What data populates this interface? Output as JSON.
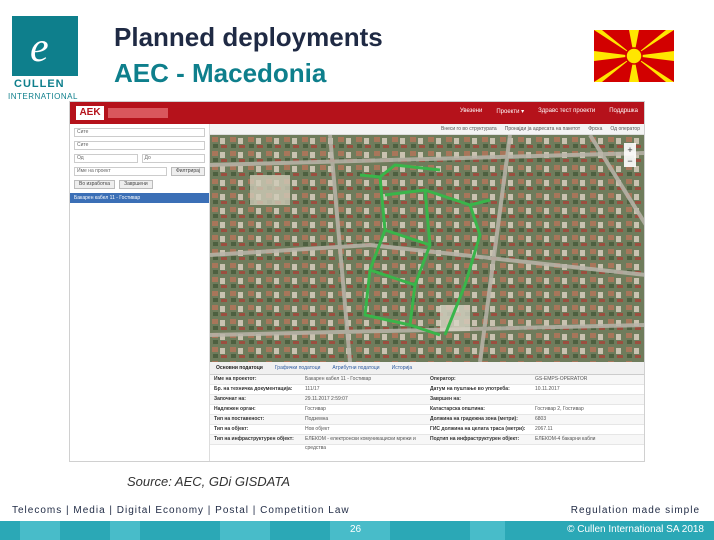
{
  "header": {
    "logo_name": "CULLEN",
    "logo_sub": "INTERNATIONAL",
    "title": "Planned deployments",
    "subtitle": "AEC - Macedonia"
  },
  "flag": {
    "field_color": "#d20000",
    "sun_color": "#ffe600"
  },
  "app": {
    "logo": "AEK",
    "menu": [
      "Увезени",
      "Проекти ▾",
      "Здравс тест проекти",
      "Поддршка"
    ],
    "bar2": [
      "Внеси го во структурата",
      "Пронајди ја адресата на пакетот",
      "Фрска",
      "Од оператор"
    ],
    "filters": {
      "field1": "Сите",
      "field2": "Сите",
      "from": "Од",
      "to": "До",
      "search": "Име на проект",
      "filter_btn": "Филтрирај",
      "btn1": "Во изработка",
      "btn2": "Завршени",
      "result": "Бакарен кабел 11 - Гостивар"
    },
    "tabs": [
      "Основни податоци",
      "Графички податоци",
      "Атрибутни податоци",
      "Историја"
    ],
    "info": [
      [
        "Име на проектот:",
        "Бакарен кабел 11 - Гостивар",
        "Оператор:",
        "GS-EMPS-OPERATOR"
      ],
      [
        "Бр. на техничка документација:",
        "111/17",
        "Датум на пуштање во употреба:",
        "10.11.2017"
      ],
      [
        "Започнат на:",
        "29.11.2017 2:59:07",
        "Завршен на:",
        ""
      ],
      [
        "Надлежен орган:",
        "Гостивар",
        "Катастарска општина:",
        "Гостивар 2, Гостивар"
      ],
      [
        "Тип на поставеност:",
        "Подземна",
        "Должина на градежна зона (метри):",
        "6803"
      ],
      [
        "Тип на објект:",
        "Нов објект",
        "ГИС должина на целата траса (метри):",
        "2067.11"
      ],
      [
        "Тип на инфраструктурен објект:",
        "ЕЛЕКОМ - електронски комуникациски мрежи и средства",
        "Подтип на инфраструктурен објект:",
        "ЕЛЕКОМ-4 бакарни кабли"
      ]
    ]
  },
  "source": "Source: AEC, GDi GISDATA",
  "footer": {
    "categories": "Telecoms  |  Media  |  Digital Economy  |  Postal  |  Competition Law",
    "tagline": "Regulation made simple",
    "page": "26",
    "copyright": "© Cullen International SA 2018"
  },
  "colors": {
    "title": "#1f2a44",
    "accent": "#0e7f8c",
    "app_bar": "#b5121b",
    "route": "#39b54a",
    "footer_bar": "#2ba8b6"
  }
}
